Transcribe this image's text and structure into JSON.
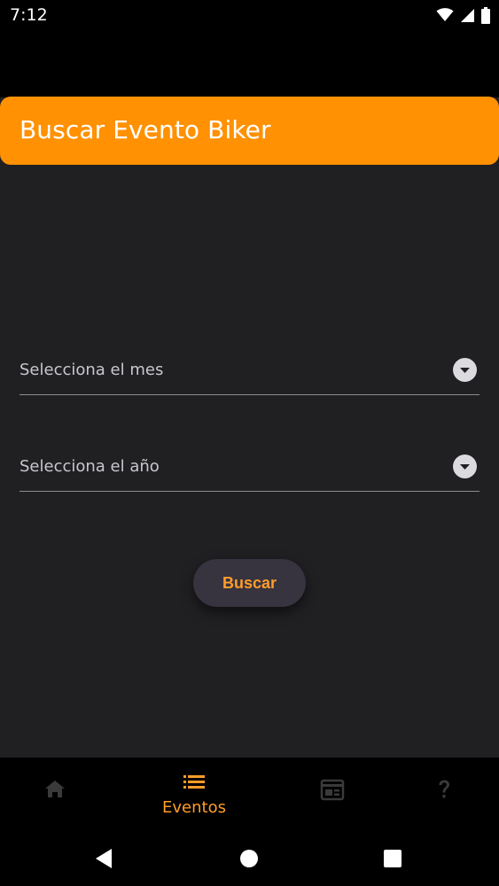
{
  "status_bar": {
    "time": "7:12",
    "icons": [
      "wifi-icon",
      "signal-icon",
      "battery-icon"
    ]
  },
  "app_bar": {
    "title": "Buscar Evento Biker",
    "color": "#ff9103"
  },
  "form": {
    "month_dropdown": {
      "placeholder": "Selecciona el mes",
      "icon": "chevron-down-icon"
    },
    "year_dropdown": {
      "placeholder": "Selecciona el año",
      "icon": "chevron-down-icon"
    },
    "search_button": {
      "label": "Buscar"
    }
  },
  "bottom_nav": {
    "items": [
      {
        "icon": "home-icon",
        "label": "",
        "active": false
      },
      {
        "icon": "list-icon",
        "label": "Eventos",
        "active": true
      },
      {
        "icon": "calendar-icon",
        "label": "",
        "active": false
      },
      {
        "icon": "help-icon",
        "label": "",
        "active": false
      }
    ],
    "active_color": "#ff9d2a",
    "inactive_color": "#3a3a3a"
  },
  "system_nav": {
    "buttons": [
      "back-icon",
      "home-circle-icon",
      "recents-icon"
    ]
  }
}
